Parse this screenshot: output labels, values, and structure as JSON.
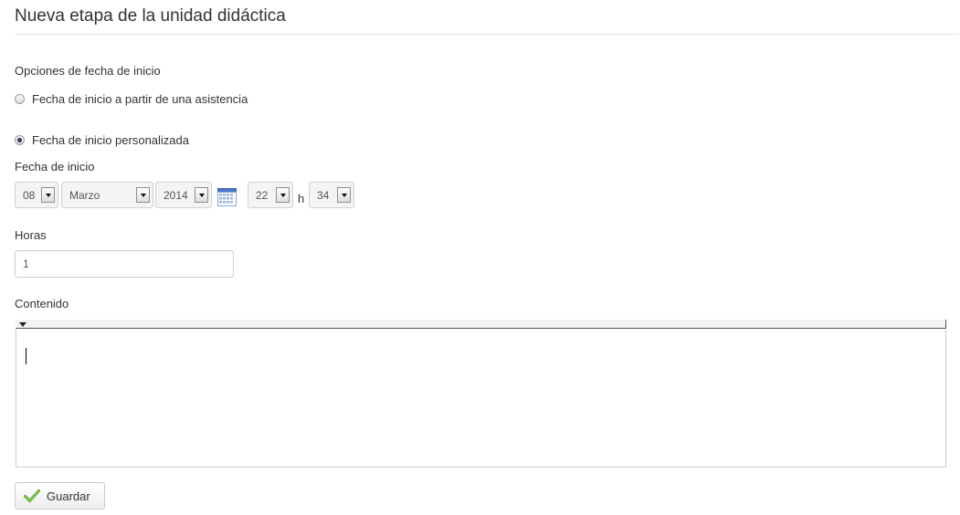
{
  "page": {
    "title": "Nueva etapa de la unidad didáctica"
  },
  "start_options": {
    "heading": "Opciones de fecha de inicio",
    "option_attendance": "Fecha de inicio a partir de una asistencia",
    "option_custom": "Fecha de inicio personalizada",
    "selected": "custom"
  },
  "start_date": {
    "label": "Fecha de inicio",
    "day": "08",
    "month": "Marzo",
    "year": "2014",
    "hour": "22",
    "hour_suffix": "h",
    "minute": "34"
  },
  "hours": {
    "label": "Horas",
    "value": "1"
  },
  "content": {
    "label": "Contenido",
    "value": ""
  },
  "actions": {
    "save_label": "Guardar"
  },
  "colors": {
    "save_check": "#5aa12c",
    "calendar": "#4a78c8"
  }
}
